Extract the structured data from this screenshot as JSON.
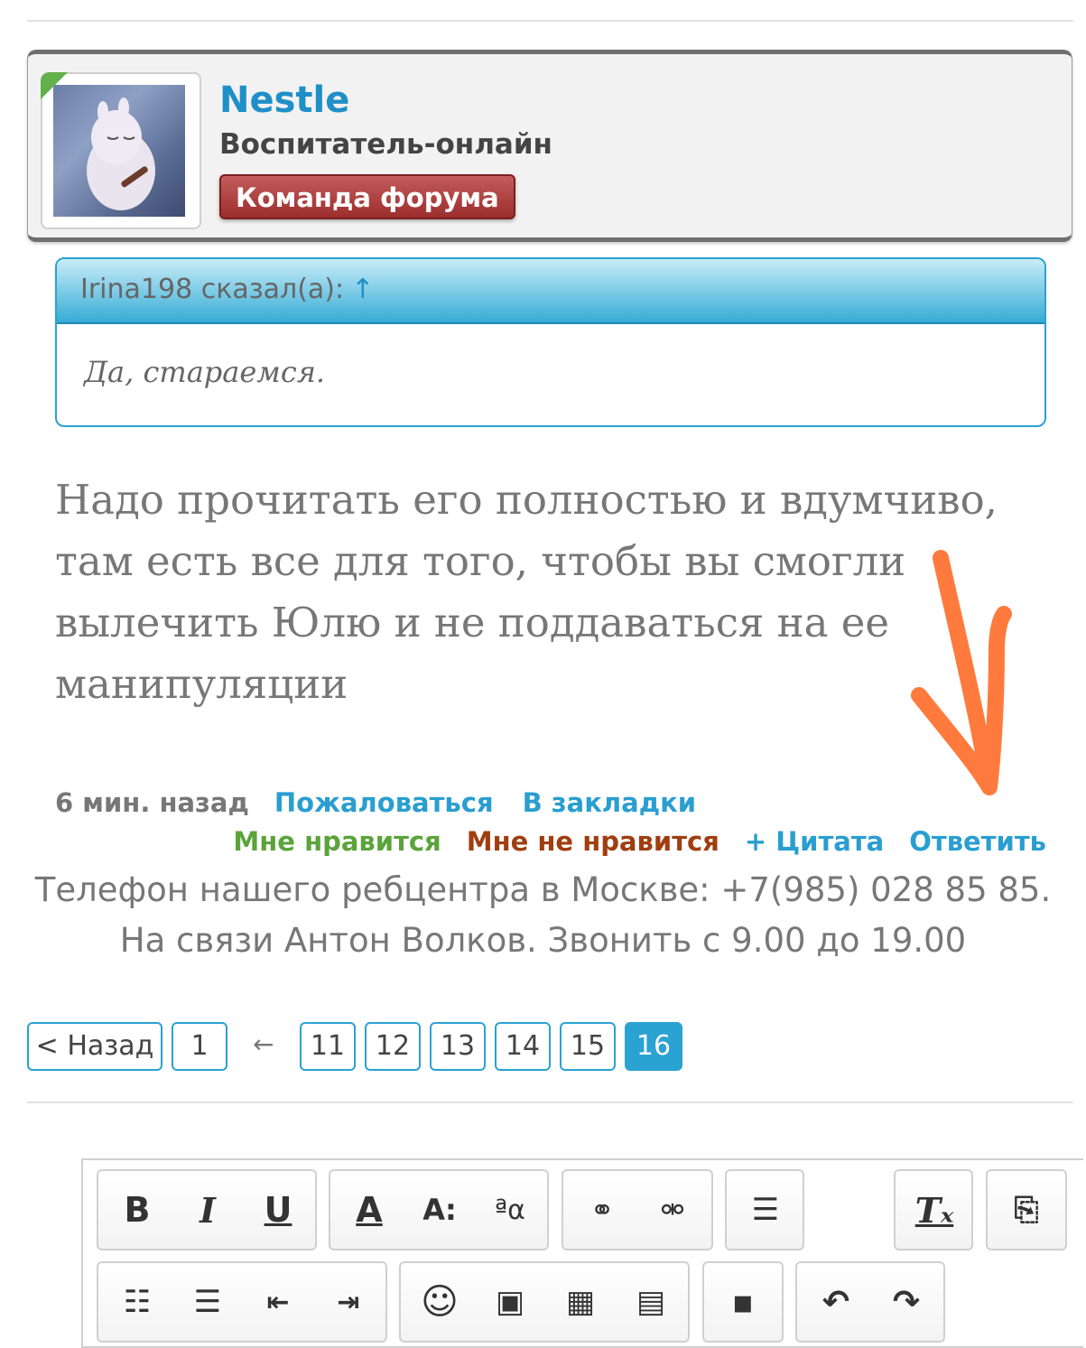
{
  "user": {
    "name": "Nestle",
    "title": "Воспитатель-онлайн",
    "badge": "Команда форума"
  },
  "quote": {
    "author_line": "Irina198 сказал(а):",
    "arrow": "↑",
    "text": "Да, стараемся."
  },
  "post": {
    "text": "Надо прочитать его полностью и вдумчиво, там есть все для того, чтобы вы смогли вылечить Юлю и не поддаваться на ее манипуляции"
  },
  "meta": {
    "time": "6 мин. назад",
    "report": "Пожаловаться",
    "bookmark": "В закладки",
    "like": "Мне нравится",
    "dislike": "Мне не нравится",
    "quote": "+ Цитата",
    "reply": "Ответить"
  },
  "signature": {
    "line1": "Телефон нашего ребцентра в Москве: +7(985) 028 85 85.",
    "line2": "На связи Антон Волков. Звонить с 9.00 до 19.00"
  },
  "pagination": {
    "prev": "< Назад",
    "first": "1",
    "ellipsis": "←",
    "pages": [
      "11",
      "12",
      "13",
      "14",
      "15"
    ],
    "current": "16"
  },
  "colors": {
    "accent": "#2aa2d2",
    "link": "#1f8fc7",
    "like": "#5ba33a",
    "dislike": "#a03e10",
    "annotation_arrow": "#ff7a3c"
  },
  "editor_icons": {
    "row1": [
      "bold-icon",
      "italic-icon",
      "underline-icon",
      "font-color-icon",
      "font-size-icon",
      "font-family-icon",
      "link-icon",
      "unlink-icon",
      "align-icon",
      "remove-format-icon",
      "switch-mode-icon"
    ],
    "row2": [
      "bullet-list-icon",
      "numbered-list-icon",
      "outdent-icon",
      "indent-icon",
      "smilie-icon",
      "image-icon",
      "media-icon",
      "insert-icon",
      "save-draft-icon",
      "undo-icon",
      "redo-icon"
    ]
  }
}
